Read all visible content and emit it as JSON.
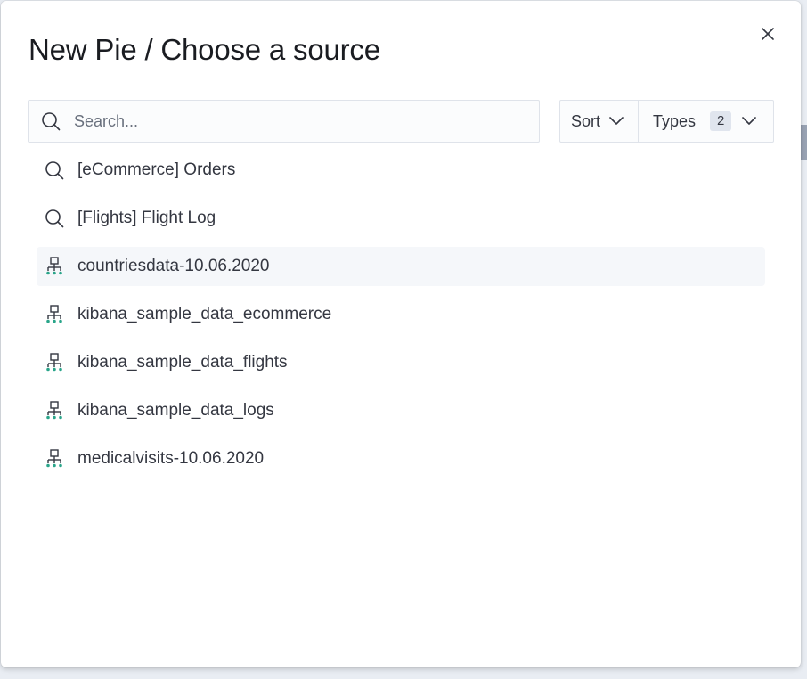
{
  "modal": {
    "title": "New Pie / Choose a source",
    "close_icon": "close-icon"
  },
  "search": {
    "placeholder": "Search...",
    "value": "",
    "icon": "search-icon"
  },
  "filters": {
    "sort_label": "Sort",
    "types_label": "Types",
    "types_count": "2"
  },
  "list": {
    "items": [
      {
        "label": "[eCommerce] Orders",
        "icon": "search-icon",
        "selected": false
      },
      {
        "label": "[Flights] Flight Log",
        "icon": "search-icon",
        "selected": false
      },
      {
        "label": "countriesdata-10.06.2020",
        "icon": "index-pattern-icon",
        "selected": true
      },
      {
        "label": "kibana_sample_data_ecommerce",
        "icon": "index-pattern-icon",
        "selected": false
      },
      {
        "label": "kibana_sample_data_flights",
        "icon": "index-pattern-icon",
        "selected": false
      },
      {
        "label": "kibana_sample_data_logs",
        "icon": "index-pattern-icon",
        "selected": false
      },
      {
        "label": "medicalvisits-10.06.2020",
        "icon": "index-pattern-icon",
        "selected": false
      }
    ]
  },
  "colors": {
    "text": "#343741",
    "title": "#1a1c21",
    "icon_gray": "#343741",
    "index_icon_accent": "#2aa58a"
  }
}
